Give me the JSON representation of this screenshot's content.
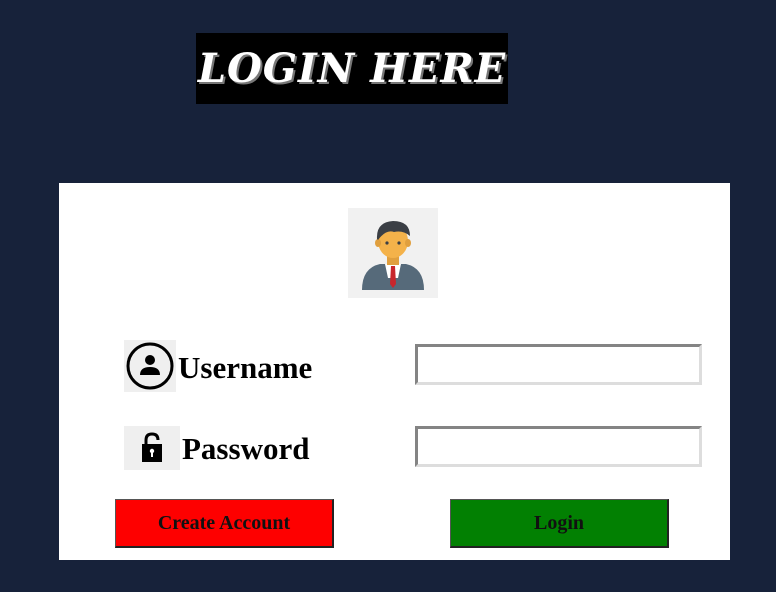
{
  "header": {
    "title": "LOGIN HERE"
  },
  "form": {
    "username_label": "Username",
    "username_value": "",
    "password_label": "Password",
    "password_value": "",
    "create_account_label": "Create Account",
    "login_label": "Login"
  },
  "icons": {
    "avatar": "user-avatar-icon",
    "username": "user-circle-icon",
    "password": "padlock-icon"
  },
  "colors": {
    "background": "#17223a",
    "create_account_button": "#fe0000",
    "login_button": "#028002"
  }
}
